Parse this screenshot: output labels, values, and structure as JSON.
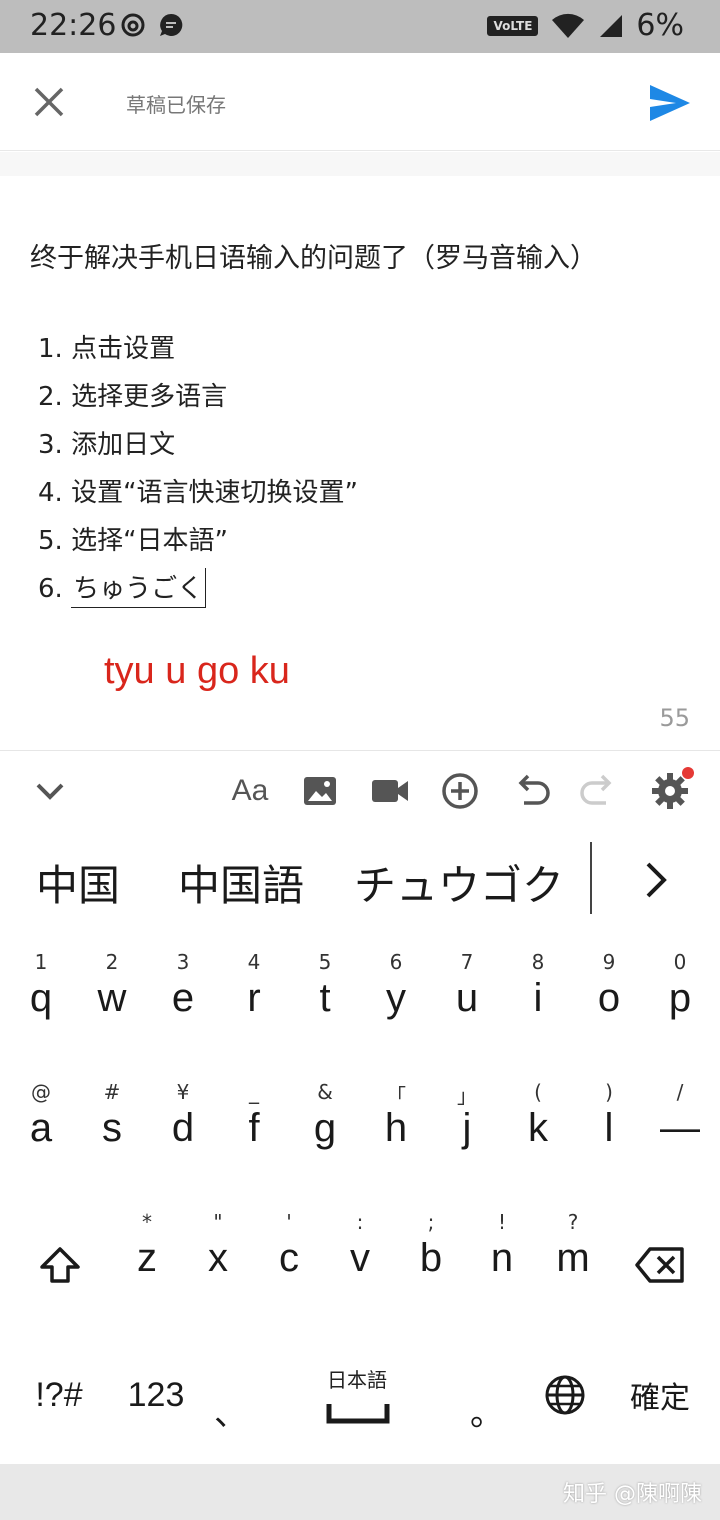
{
  "status_bar": {
    "time": "22:26",
    "volte": "VoLTE",
    "battery": "6%"
  },
  "header": {
    "draft_status": "草稿已保存"
  },
  "editor": {
    "title": "终于解决手机日语输入的问题了（罗马音输入）",
    "steps": [
      "1. 点击设置",
      "2.  选择更多语言",
      "3. 添加日文",
      "4. 设置“语言快速切换设置”",
      "5. 选择“日本語”"
    ],
    "step6_number": "6.",
    "step6_text": "ちゅうごく",
    "annotation": "tyu u go ku",
    "char_count": "55"
  },
  "toolbar": {
    "font_label": "Aa"
  },
  "candidates": [
    "中国",
    "中国語",
    "チュウゴク"
  ],
  "keyboard": {
    "row1": [
      {
        "hint": "1",
        "key": "q"
      },
      {
        "hint": "2",
        "key": "w"
      },
      {
        "hint": "3",
        "key": "e"
      },
      {
        "hint": "4",
        "key": "r"
      },
      {
        "hint": "5",
        "key": "t"
      },
      {
        "hint": "6",
        "key": "y"
      },
      {
        "hint": "7",
        "key": "u"
      },
      {
        "hint": "8",
        "key": "i"
      },
      {
        "hint": "9",
        "key": "o"
      },
      {
        "hint": "0",
        "key": "p"
      }
    ],
    "row2": [
      {
        "hint": "@",
        "key": "a"
      },
      {
        "hint": "#",
        "key": "s"
      },
      {
        "hint": "¥",
        "key": "d"
      },
      {
        "hint": "_",
        "key": "f"
      },
      {
        "hint": "&",
        "key": "g"
      },
      {
        "hint": "「",
        "key": "h"
      },
      {
        "hint": "」",
        "key": "j"
      },
      {
        "hint": "(",
        "key": "k"
      },
      {
        "hint": ")",
        "key": "l"
      },
      {
        "hint": "/",
        "key": "—"
      }
    ],
    "row3": [
      {
        "hint": "*",
        "key": "z"
      },
      {
        "hint": "\"",
        "key": "x"
      },
      {
        "hint": "'",
        "key": "c"
      },
      {
        "hint": ":",
        "key": "v"
      },
      {
        "hint": ";",
        "key": "b"
      },
      {
        "hint": "!",
        "key": "n"
      },
      {
        "hint": "?",
        "key": "m"
      }
    ],
    "symbols_label": "!?#",
    "numbers_label": "123",
    "comma_label": "、",
    "space_label": "日本語",
    "period_label": "。",
    "enter_label": "確定"
  },
  "nav_bar": {
    "watermark": "知乎 @陳啊陳"
  }
}
